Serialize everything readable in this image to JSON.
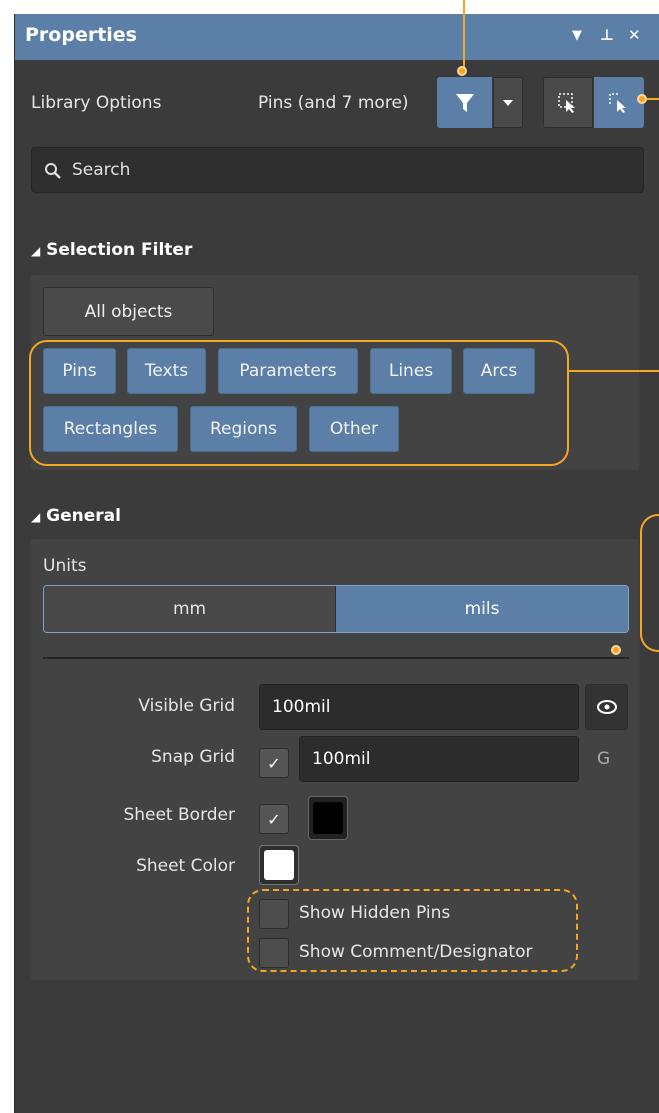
{
  "titlebar": {
    "title": "Properties",
    "menu_icon": "chevron-down-icon",
    "pin_icon": "pin-icon",
    "close_icon": "close-icon"
  },
  "toolbar": {
    "library_options": "Library Options",
    "filter_summary": "Pins (and 7 more)"
  },
  "search": {
    "placeholder": "Search"
  },
  "selection_filter": {
    "header": "Selection Filter",
    "all_objects": "All objects",
    "chips": [
      "Pins",
      "Texts",
      "Parameters",
      "Lines",
      "Arcs",
      "Rectangles",
      "Regions",
      "Other"
    ]
  },
  "general": {
    "header": "General",
    "units_label": "Units",
    "units": [
      "mm",
      "mils"
    ],
    "units_selected": "mils",
    "visible_grid_label": "Visible Grid",
    "visible_grid_value": "100mil",
    "snap_grid_label": "Snap Grid",
    "snap_grid_value": "100mil",
    "snap_grid_shortcut": "G",
    "sheet_border_label": "Sheet Border",
    "sheet_color_label": "Sheet Color",
    "show_hidden_pins": "Show Hidden Pins",
    "show_comment": "Show Comment/Designator"
  },
  "colors": {
    "accent": "#5b7fa6",
    "panel": "#3b3b3b",
    "callout": "#f5a623",
    "sheet_border_color": "#000000",
    "sheet_color": "#ffffff"
  }
}
